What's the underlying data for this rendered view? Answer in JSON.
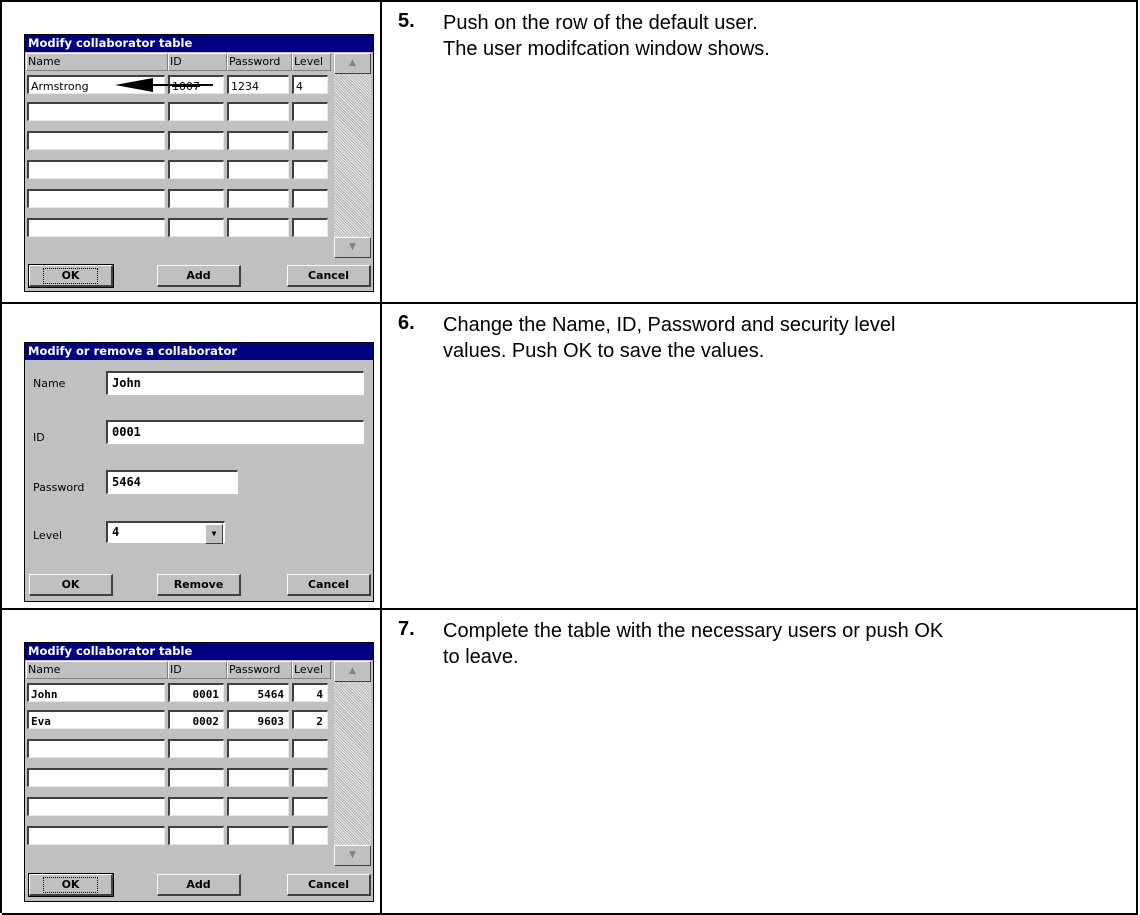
{
  "steps": [
    {
      "number": "5.",
      "lines": [
        "Push on the row of the default user.",
        "The user modifcation window shows."
      ]
    },
    {
      "number": "6.",
      "lines": [
        "Change the Name, ID, Password and security level",
        "values. Push OK to save the values."
      ]
    },
    {
      "number": "7.",
      "lines": [
        "Complete the table with the necessary users or push OK",
        "to leave."
      ]
    }
  ],
  "table_dialog_1": {
    "title": "Modify collaborator table",
    "headers": [
      "Name",
      "ID",
      "Password",
      "Level"
    ],
    "rows": [
      [
        "Armstrong",
        "1007",
        "1234",
        "4"
      ],
      [
        "",
        "",
        "",
        ""
      ],
      [
        "",
        "",
        "",
        ""
      ],
      [
        "",
        "",
        "",
        ""
      ],
      [
        "",
        "",
        "",
        ""
      ],
      [
        "",
        "",
        "",
        ""
      ]
    ],
    "buttons": {
      "ok": "OK",
      "add": "Add",
      "cancel": "Cancel"
    }
  },
  "edit_dialog": {
    "title": "Modify or remove a collaborator",
    "fields": {
      "name_label": "Name",
      "name_value": "John",
      "id_label": "ID",
      "id_value": "0001",
      "password_label": "Password",
      "password_value": "5464",
      "level_label": "Level",
      "level_value": "4"
    },
    "buttons": {
      "ok": "OK",
      "remove": "Remove",
      "cancel": "Cancel"
    }
  },
  "table_dialog_2": {
    "title": "Modify collaborator table",
    "headers": [
      "Name",
      "ID",
      "Password",
      "Level"
    ],
    "rows": [
      [
        "John",
        "0001",
        "5464",
        "4"
      ],
      [
        "Eva",
        "0002",
        "9603",
        "2"
      ],
      [
        "",
        "",
        "",
        ""
      ],
      [
        "",
        "",
        "",
        ""
      ],
      [
        "",
        "",
        "",
        ""
      ],
      [
        "",
        "",
        "",
        ""
      ]
    ],
    "buttons": {
      "ok": "OK",
      "add": "Add",
      "cancel": "Cancel"
    }
  },
  "colors": {
    "titlebar": "#000080",
    "dialog": "#c0c0c0"
  },
  "icons": {
    "scroll_up": "scroll-up-arrow-icon",
    "scroll_down": "scroll-down-arrow-icon",
    "dropdown": "dropdown-arrow-icon",
    "pointer": "pointer-arrow-icon"
  }
}
